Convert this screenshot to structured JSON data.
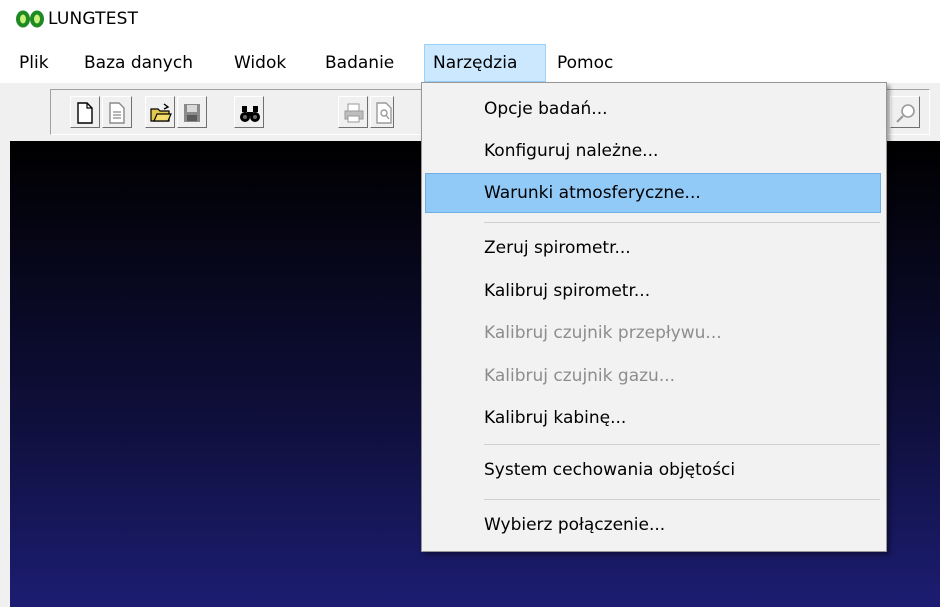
{
  "window": {
    "title": "LUNGTEST",
    "icon": "lungs-icon"
  },
  "menubar": {
    "items": [
      {
        "label": "Plik"
      },
      {
        "label": "Baza danych"
      },
      {
        "label": "Widok"
      },
      {
        "label": "Badanie"
      },
      {
        "label": "Narzędzia"
      },
      {
        "label": "Pomoc"
      }
    ],
    "active_index": 4
  },
  "toolbar": {
    "buttons": [
      "new-document-icon",
      "document-icon",
      "open-folder-icon",
      "save-icon",
      "binoculars-find-icon",
      "print-icon",
      "print-preview-icon",
      "zoom-icon"
    ]
  },
  "tools_menu": {
    "items": [
      {
        "label": "Opcje badań...",
        "enabled": true
      },
      {
        "label": "Konfiguruj należne...",
        "enabled": true
      },
      {
        "label": "Warunki atmosferyczne...",
        "enabled": true,
        "highlighted": true
      },
      {
        "label": "Zeruj spirometr...",
        "enabled": true
      },
      {
        "label": "Kalibruj spirometr...",
        "enabled": true
      },
      {
        "label": "Kalibruj czujnik przepływu...",
        "enabled": false
      },
      {
        "label": "Kalibruj czujnik gazu...",
        "enabled": false
      },
      {
        "label": "Kalibruj kabinę...",
        "enabled": true
      },
      {
        "label": "System cechowania objętości",
        "enabled": true
      },
      {
        "label": "Wybierz połączenie...",
        "enabled": true
      }
    ]
  },
  "colors": {
    "highlight": "#91c9f7",
    "active_menu": "#cce8ff",
    "workspace_bottom": "#1c1d72"
  }
}
